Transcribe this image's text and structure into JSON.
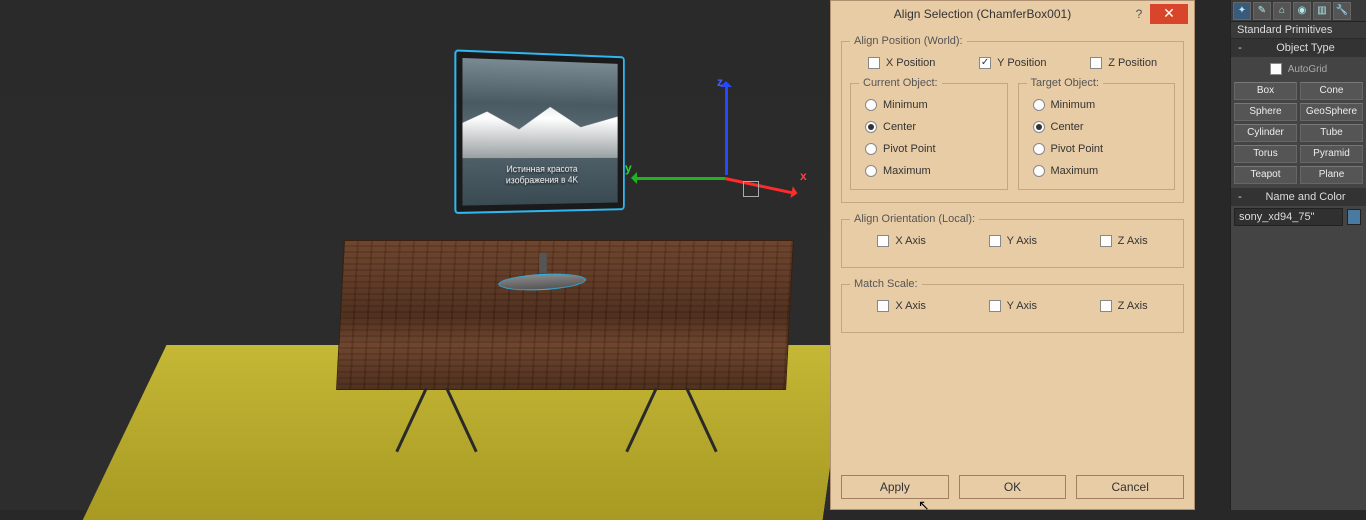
{
  "viewport": {
    "tv_line1": "Истинная красота",
    "tv_line2": "изображения в 4K",
    "axis_labels": {
      "x": "x",
      "y": "y",
      "z": "z"
    }
  },
  "dialog": {
    "title": "Align Selection (ChamferBox001)",
    "help": "?",
    "close": "✕",
    "align_position": {
      "legend": "Align Position (World):",
      "x": {
        "label": "X Position",
        "checked": false
      },
      "y": {
        "label": "Y Position",
        "checked": true
      },
      "z": {
        "label": "Z Position",
        "checked": false
      },
      "current": {
        "legend": "Current Object:",
        "options": [
          "Minimum",
          "Center",
          "Pivot Point",
          "Maximum"
        ],
        "selected": "Center"
      },
      "target": {
        "legend": "Target Object:",
        "options": [
          "Minimum",
          "Center",
          "Pivot Point",
          "Maximum"
        ],
        "selected": "Center"
      }
    },
    "align_orientation": {
      "legend": "Align Orientation (Local):",
      "x": {
        "label": "X Axis",
        "checked": false
      },
      "y": {
        "label": "Y Axis",
        "checked": false
      },
      "z": {
        "label": "Z Axis",
        "checked": false
      }
    },
    "match_scale": {
      "legend": "Match Scale:",
      "x": {
        "label": "X Axis",
        "checked": false
      },
      "y": {
        "label": "Y Axis",
        "checked": false
      },
      "z": {
        "label": "Z Axis",
        "checked": false
      }
    },
    "buttons": {
      "apply": "Apply",
      "ok": "OK",
      "cancel": "Cancel"
    }
  },
  "panel": {
    "dropdown": "Standard Primitives",
    "object_type": {
      "header": "Object Type",
      "autogrid": "AutoGrid",
      "buttons": [
        "Box",
        "Cone",
        "Sphere",
        "GeoSphere",
        "Cylinder",
        "Tube",
        "Torus",
        "Pyramid",
        "Teapot",
        "Plane"
      ]
    },
    "name_color": {
      "header": "Name and Color",
      "name": "sony_xd94_75\""
    }
  }
}
